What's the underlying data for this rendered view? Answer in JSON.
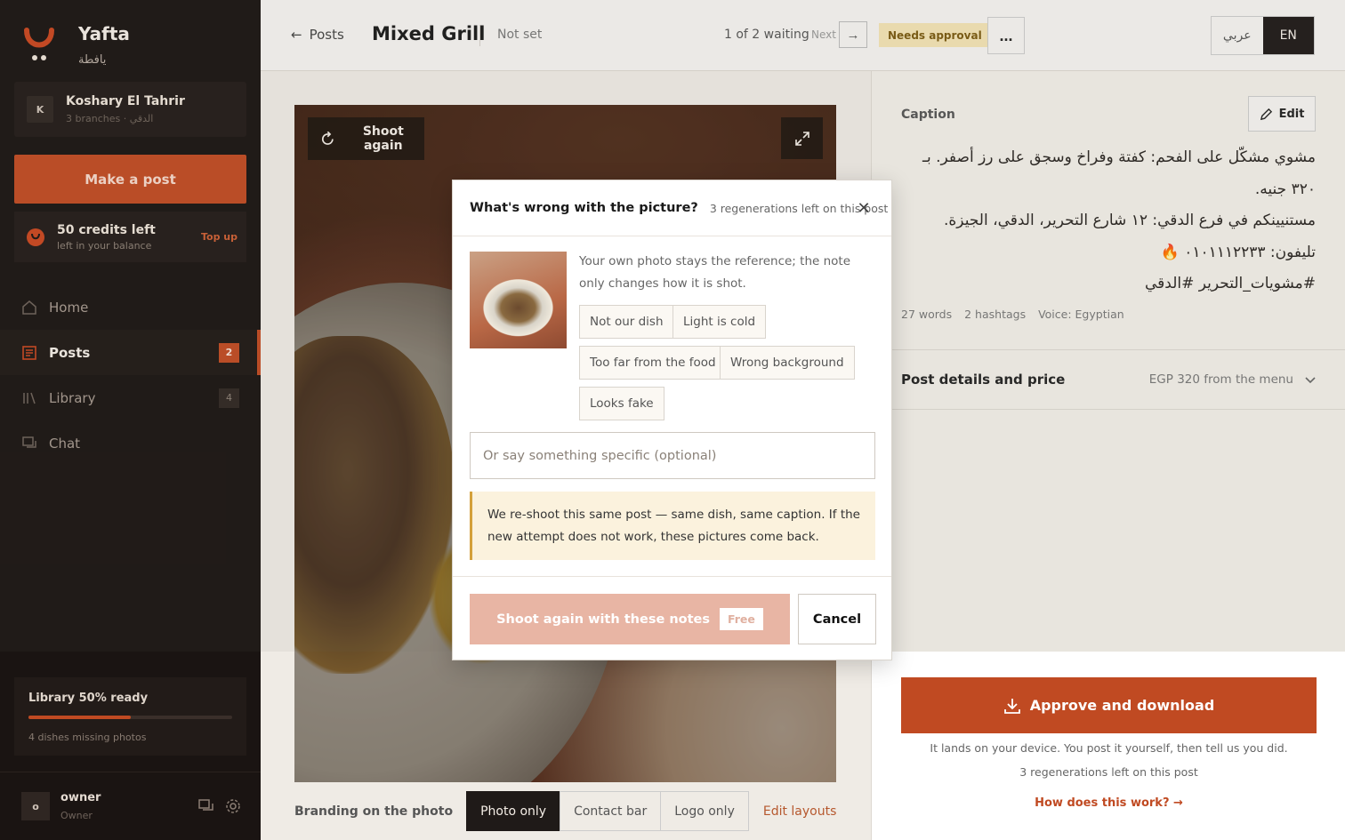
{
  "sidebar": {
    "brand": {
      "name": "Yafta",
      "name_ar": "يافطة"
    },
    "restaurant": {
      "initial": "K",
      "name": "Koshary El Tahrir",
      "sub": "3 branches · الدقي"
    },
    "make_post": "Make a post",
    "credits": {
      "title": "50 credits left",
      "sub": "left in your balance",
      "topup": "Top up"
    },
    "nav": [
      {
        "label": "Home",
        "icon": "home-icon"
      },
      {
        "label": "Posts",
        "icon": "posts-icon",
        "badge": "2"
      },
      {
        "label": "Library",
        "icon": "library-icon",
        "badge": "4"
      },
      {
        "label": "Chat",
        "icon": "chat-icon"
      }
    ],
    "library": {
      "title": "Library 50% ready",
      "progress": 0.5,
      "sub": "4 dishes missing photos"
    },
    "user": {
      "initial": "o",
      "name": "owner",
      "role": "Owner"
    }
  },
  "header": {
    "back": "Posts",
    "title": "Mixed Grill",
    "status": "Not set",
    "waiting": "1 of 2 waiting",
    "next": "Next",
    "badge": "Needs approval",
    "more": "...",
    "lang_ar": "عربي",
    "lang_en": "EN"
  },
  "stage": {
    "shoot_again": "Shoot again",
    "branding_label": "Branding on the photo",
    "branding_options": [
      "Photo only",
      "Contact bar",
      "Logo only"
    ],
    "selected_branding": "Photo only",
    "edit_layouts": "Edit layouts"
  },
  "panel": {
    "caption_label": "Caption",
    "edit": "Edit",
    "caption_lines": [
      "مشوي مشكّل على الفحم: كفتة وفراخ وسجق على رز أصفر. بـ ٣٢٠ جنيه.",
      "مستنيينكم في فرع الدقي: ١٢ شارع التحرير، الدقي، الجيزة.",
      "تليفون: ٠١٠١١١٢٢٣٣ 🔥",
      "#مشويات_التحرير #الدقي"
    ],
    "meta": {
      "words": "27 words",
      "hashtags": "2 hashtags",
      "voice": "Voice: Egyptian"
    },
    "details_title": "Post details and price",
    "details_value": "EGP 320 from the menu",
    "approve": "Approve and download",
    "approve_note": "It lands on your device. You post it yourself, then tell us you did.",
    "approve_regen": "3 regenerations left on this post",
    "how": "How does this work? →"
  },
  "modal": {
    "title": "What's wrong with the picture?",
    "regen": "3 regenerations left on this post",
    "help": "Your own photo stays the reference; the note only changes how it is shot.",
    "chips": [
      "Not our dish",
      "Light is cold",
      "Too far from the food",
      "Wrong background",
      "Looks fake"
    ],
    "input_placeholder": "Or say something specific (optional)",
    "note": "We re-shoot this same post — same dish, same caption. If the new attempt does not work, these pictures come back.",
    "submit": "Shoot again with these notes",
    "free": "Free",
    "cancel": "Cancel"
  },
  "colors": {
    "accent": "#c04a22",
    "sidebar_bg": "#1a1412",
    "needs_approval_bg": "#f4e3b5"
  }
}
